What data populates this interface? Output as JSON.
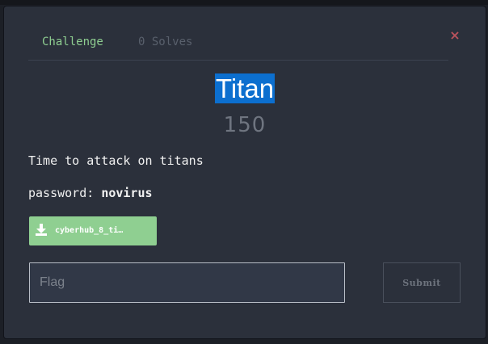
{
  "modal": {
    "tabs": [
      {
        "label": "Challenge"
      },
      {
        "label": "0 Solves"
      }
    ],
    "close_symbol": "×",
    "title": "Titan",
    "points": "150",
    "description": "Time to attack on titans",
    "password_label": "password:",
    "password_value": "novirus",
    "file": {
      "label": "cyberhub_8_ti…",
      "icon": "download-icon"
    },
    "flag_input": {
      "placeholder": "Flag",
      "value": ""
    },
    "submit_label": "Submit"
  },
  "colors": {
    "modal_background": "#2b303b",
    "accent_green": "#8fcf91",
    "title_highlight": "#0c6fcf",
    "close_red": "#b9525c",
    "input_background": "#313847"
  }
}
